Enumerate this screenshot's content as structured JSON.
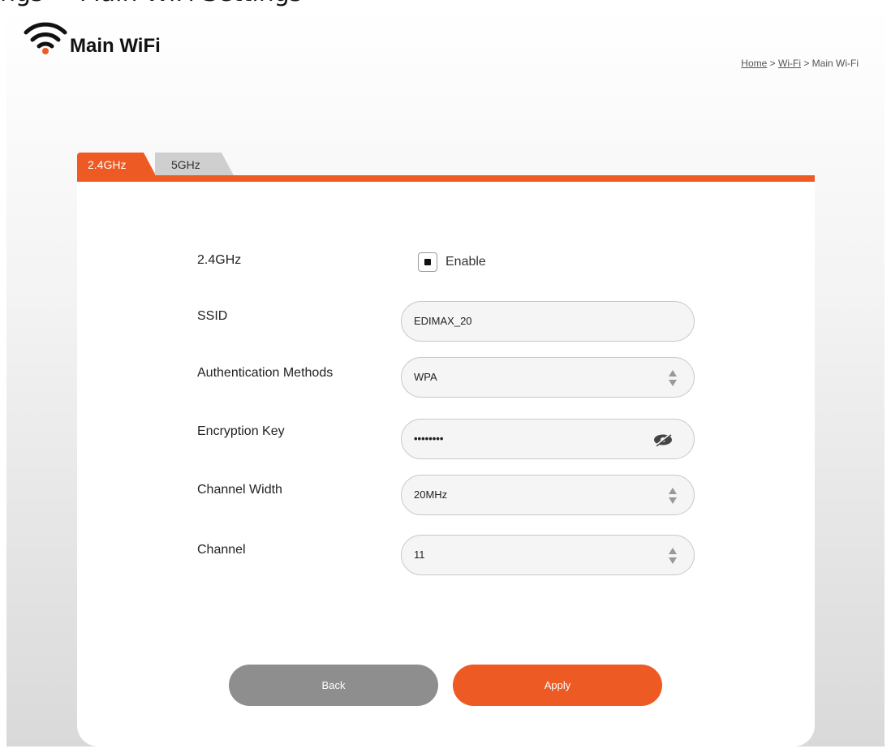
{
  "cut_heading": "ngs → Main WiFi Settings",
  "header": {
    "title": "Main WiFi",
    "breadcrumb": {
      "home": "Home",
      "sep1": " > ",
      "wifi": "Wi-Fi",
      "sep2": " > ",
      "current": "Main Wi-Fi"
    }
  },
  "tabs": [
    {
      "label": "2.4GHz",
      "active": true
    },
    {
      "label": "5GHz",
      "active": false
    }
  ],
  "form": {
    "band": {
      "label": "2.4GHz",
      "checkbox_label": "Enable",
      "checked": true
    },
    "ssid": {
      "label": "SSID",
      "value": "EDIMAX_20"
    },
    "auth": {
      "label": "Authentication Methods",
      "value": "WPA"
    },
    "key": {
      "label": "Encryption Key",
      "value": "••••••••"
    },
    "width": {
      "label": "Channel Width",
      "value": "20MHz"
    },
    "channel": {
      "label": "Channel",
      "value": "11"
    }
  },
  "buttons": {
    "back": "Back",
    "apply": "Apply"
  },
  "colors": {
    "accent": "#ee5a24",
    "back_button": "#8e8e8e",
    "inactive_tab": "#cfcfcf"
  },
  "icons": [
    "wifi-icon",
    "select-arrows-icon",
    "eye-hidden-icon"
  ]
}
